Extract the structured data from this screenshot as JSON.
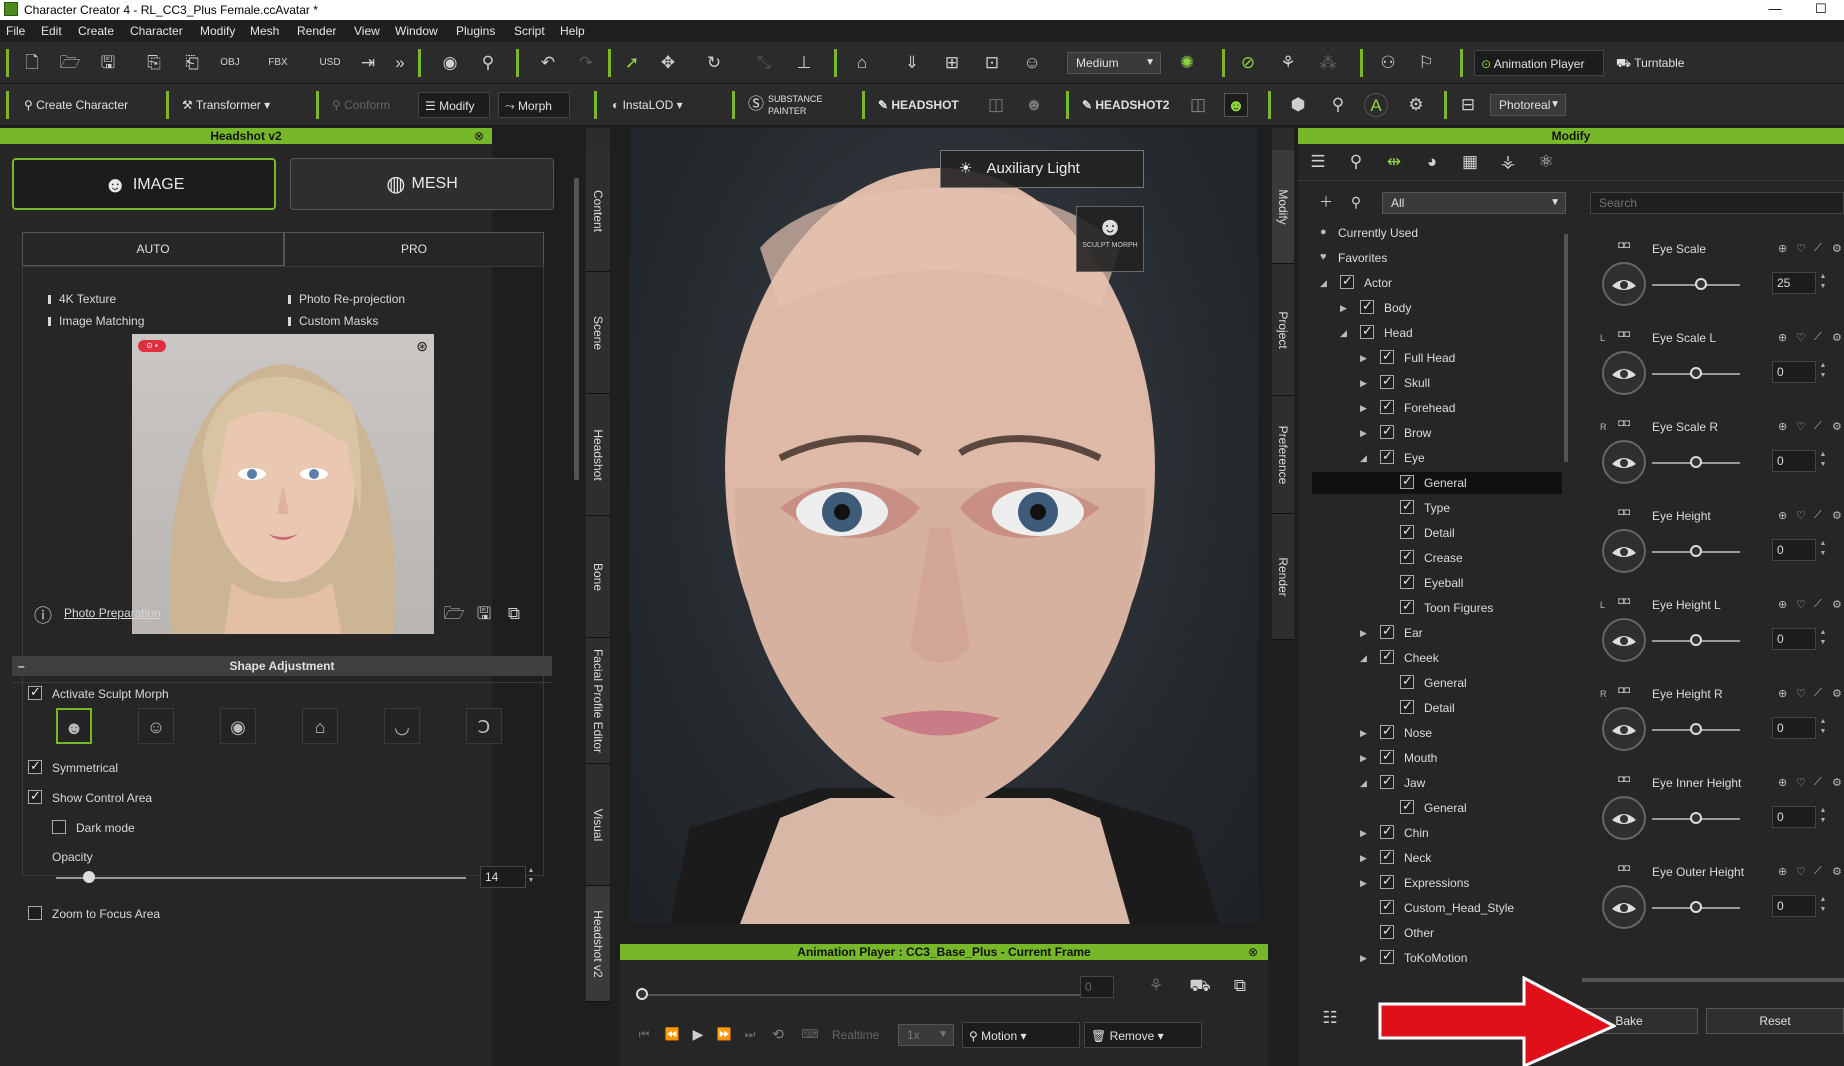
{
  "window": {
    "title": "Character Creator 4 - RL_CC3_Plus Female.ccAvatar *",
    "min": "—",
    "max": "☐"
  },
  "menu": [
    "File",
    "Edit",
    "Create",
    "Character",
    "Modify",
    "Mesh",
    "Render",
    "View",
    "Window",
    "Plugins",
    "Script",
    "Help"
  ],
  "toolbar1": {
    "quality_select": "Medium",
    "animation_player": "Animation Player",
    "turntable": "Turntable"
  },
  "toolbar2": {
    "create_character": "Create Character",
    "transformer": "Transformer",
    "conform": "Conform",
    "modify": "Modify",
    "morph": "Morph",
    "instalod": "InstaLOD",
    "substance_painter": "SUBSTANCE PAINTER",
    "headshot": "HEADSHOT",
    "headshot2": "HEADSHOT2",
    "render_select": "Photoreal"
  },
  "left_panel": {
    "title": "Headshot v2",
    "mode_tabs": [
      "IMAGE",
      "MESH"
    ],
    "sub_tabs": [
      "AUTO",
      "PRO"
    ],
    "features": [
      "4K Texture",
      "Photo Re-projection",
      "Image Matching",
      "Custom Masks"
    ],
    "photo_prep": "Photo Preparation",
    "shape_adjustment": "Shape Adjustment",
    "activate_sculpt_morph": "Activate Sculpt Morph",
    "symmetrical": "Symmetrical",
    "show_control_area": "Show Control Area",
    "dark_mode": "Dark mode",
    "opacity_label": "Opacity",
    "opacity_value": "14",
    "opacity_fraction": 0.08,
    "zoom_to_focus": "Zoom to Focus Area"
  },
  "side_tabs_left": [
    "Content",
    "Scene",
    "Headshot",
    "Bone",
    "Facial Profile Editor",
    "Visual",
    "Headshot v2"
  ],
  "viewport": {
    "aux_light": "Auxiliary Light",
    "sculpt_morph": "SCULPT MORPH"
  },
  "animation_player": {
    "title": "Animation Player : CC3_Base_Plus - Current Frame",
    "frame": "0",
    "realtime": "Realtime",
    "speed": "1x",
    "motion": "Motion",
    "remove": "Remove"
  },
  "side_tabs_right": [
    "Modify",
    "Project",
    "Preference",
    "Render"
  ],
  "right_panel": {
    "title": "Modify",
    "filter": "All",
    "search_placeholder": "Search",
    "tree": [
      {
        "label": "Currently Used",
        "level": 0,
        "type": "dot"
      },
      {
        "label": "Favorites",
        "level": 0,
        "type": "heart"
      },
      {
        "label": "Actor",
        "level": 0,
        "type": "node",
        "open": true
      },
      {
        "label": "Body",
        "level": 1,
        "type": "node",
        "open": false
      },
      {
        "label": "Head",
        "level": 1,
        "type": "node",
        "open": true
      },
      {
        "label": "Full Head",
        "level": 2,
        "type": "node",
        "open": false
      },
      {
        "label": "Skull",
        "level": 2,
        "type": "node",
        "open": false
      },
      {
        "label": "Forehead",
        "level": 2,
        "type": "node",
        "open": false
      },
      {
        "label": "Brow",
        "level": 2,
        "type": "node",
        "open": false
      },
      {
        "label": "Eye",
        "level": 2,
        "type": "node",
        "open": true
      },
      {
        "label": "General",
        "level": 3,
        "type": "leaf",
        "selected": true
      },
      {
        "label": "Type",
        "level": 3,
        "type": "leaf"
      },
      {
        "label": "Detail",
        "level": 3,
        "type": "leaf"
      },
      {
        "label": "Crease",
        "level": 3,
        "type": "leaf"
      },
      {
        "label": "Eyeball",
        "level": 3,
        "type": "leaf"
      },
      {
        "label": "Toon Figures",
        "level": 3,
        "type": "leaf"
      },
      {
        "label": "Ear",
        "level": 2,
        "type": "node",
        "open": false
      },
      {
        "label": "Cheek",
        "level": 2,
        "type": "node",
        "open": true
      },
      {
        "label": "General",
        "level": 3,
        "type": "leaf"
      },
      {
        "label": "Detail",
        "level": 3,
        "type": "leaf"
      },
      {
        "label": "Nose",
        "level": 2,
        "type": "node",
        "open": false
      },
      {
        "label": "Mouth",
        "level": 2,
        "type": "node",
        "open": false
      },
      {
        "label": "Jaw",
        "level": 2,
        "type": "node",
        "open": true
      },
      {
        "label": "General",
        "level": 3,
        "type": "leaf"
      },
      {
        "label": "Chin",
        "level": 2,
        "type": "node",
        "open": false
      },
      {
        "label": "Neck",
        "level": 2,
        "type": "node",
        "open": false
      },
      {
        "label": "Expressions",
        "level": 2,
        "type": "node",
        "open": false
      },
      {
        "label": "Custom_Head_Style",
        "level": 2,
        "type": "leaf2"
      },
      {
        "label": "Other",
        "level": 2,
        "type": "leaf2"
      },
      {
        "label": "ToKoMotion",
        "level": 2,
        "type": "node",
        "open": false
      }
    ],
    "sliders": [
      {
        "name": "Eye Scale",
        "prefix": "",
        "value": "25",
        "fraction": 0.56
      },
      {
        "name": "Eye Scale L",
        "prefix": "L",
        "value": "0",
        "fraction": 0.5
      },
      {
        "name": "Eye Scale R",
        "prefix": "R",
        "value": "0",
        "fraction": 0.5
      },
      {
        "name": "Eye Height",
        "prefix": "",
        "value": "0",
        "fraction": 0.5
      },
      {
        "name": "Eye Height L",
        "prefix": "L",
        "value": "0",
        "fraction": 0.5
      },
      {
        "name": "Eye Height R",
        "prefix": "R",
        "value": "0",
        "fraction": 0.5
      },
      {
        "name": "Eye Inner Height",
        "prefix": "",
        "value": "0",
        "fraction": 0.5
      },
      {
        "name": "Eye Outer Height",
        "prefix": "",
        "value": "0",
        "fraction": 0.5
      }
    ],
    "bake": "Bake",
    "reset": "Reset"
  },
  "colors": {
    "accent": "#76b82a",
    "panel": "#262626",
    "arrow": "#e0101a"
  }
}
